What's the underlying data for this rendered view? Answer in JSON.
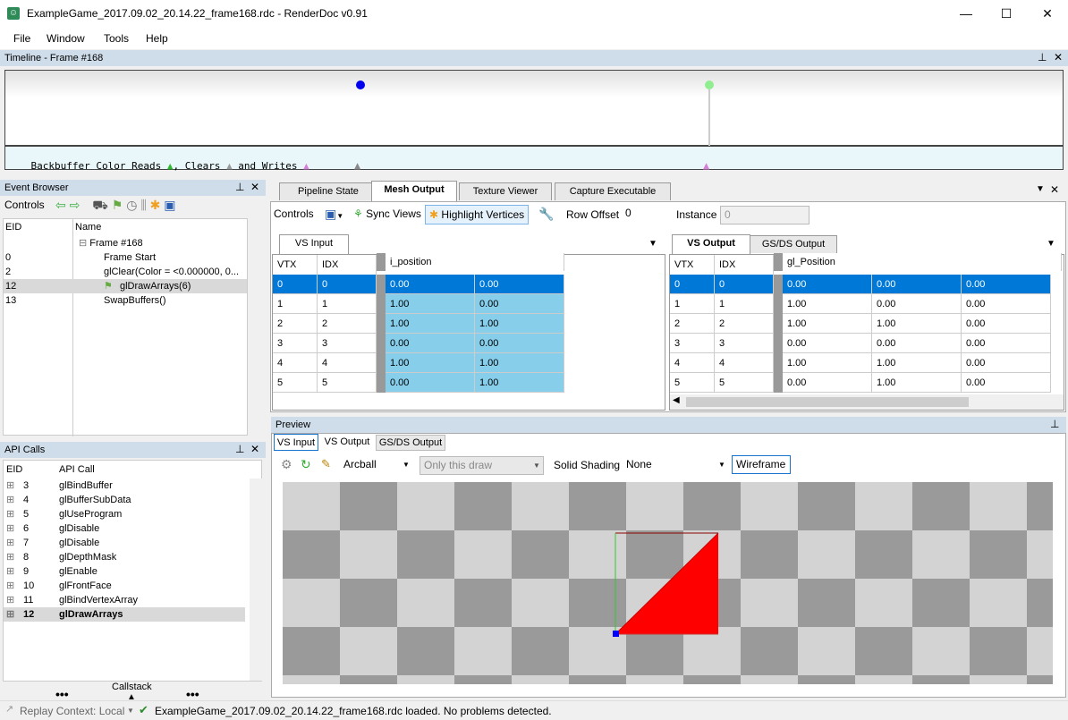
{
  "window": {
    "title": "ExampleGame_2017.09.02_20.14.22_frame168.rdc - RenderDoc v0.91",
    "minimize": "—",
    "maximize": "☐",
    "close": "✕"
  },
  "menu": [
    "File",
    "Window",
    "Tools",
    "Help"
  ],
  "timeline": {
    "title": "Timeline - Frame #168",
    "legend_a": "Backbuffer Color Reads ",
    "legend_b": ", Clears ",
    "legend_c": " and Writes "
  },
  "event_browser": {
    "title": "Event Browser",
    "controls_label": "Controls",
    "col_eid": "EID",
    "col_name": "Name",
    "rows": [
      {
        "eid": "",
        "name": "Frame #168"
      },
      {
        "eid": "0",
        "name": "Frame Start"
      },
      {
        "eid": "2",
        "name": "glClear(Color = <0.000000, 0..."
      },
      {
        "eid": "12",
        "name": "glDrawArrays(6)"
      },
      {
        "eid": "13",
        "name": "SwapBuffers()"
      }
    ]
  },
  "api_calls": {
    "title": "API Calls",
    "col_eid": "EID",
    "col_call": "API Call",
    "rows": [
      {
        "eid": "3",
        "call": "glBindBuffer"
      },
      {
        "eid": "4",
        "call": "glBufferSubData"
      },
      {
        "eid": "5",
        "call": "glUseProgram"
      },
      {
        "eid": "6",
        "call": "glDisable"
      },
      {
        "eid": "7",
        "call": "glDisable"
      },
      {
        "eid": "8",
        "call": "glDepthMask"
      },
      {
        "eid": "9",
        "call": "glEnable"
      },
      {
        "eid": "10",
        "call": "glFrontFace"
      },
      {
        "eid": "11",
        "call": "glBindVertexArray"
      },
      {
        "eid": "12",
        "call": "glDrawArrays"
      }
    ],
    "callstack": "Callstack"
  },
  "tabs": [
    "Pipeline State",
    "Mesh Output",
    "Texture Viewer",
    "Capture Executable"
  ],
  "mesh_toolbar": {
    "controls": "Controls",
    "sync_views": "Sync Views",
    "highlight_vertices": "Highlight Vertices",
    "row_offset_label": "Row Offset",
    "row_offset_value": "0",
    "instance_label": "Instance",
    "instance_value": "0"
  },
  "vs_input": {
    "tab": "VS Input",
    "col_vtx": "VTX",
    "col_idx": "IDX",
    "col_attr": "i_position",
    "rows": [
      [
        "0",
        "0",
        "0.00",
        "0.00"
      ],
      [
        "1",
        "1",
        "1.00",
        "0.00"
      ],
      [
        "2",
        "2",
        "1.00",
        "1.00"
      ],
      [
        "3",
        "3",
        "0.00",
        "0.00"
      ],
      [
        "4",
        "4",
        "1.00",
        "1.00"
      ],
      [
        "5",
        "5",
        "0.00",
        "1.00"
      ]
    ]
  },
  "vs_output": {
    "tabs": [
      "VS Output",
      "GS/DS Output"
    ],
    "col_vtx": "VTX",
    "col_idx": "IDX",
    "col_attr": "gl_Position",
    "rows": [
      [
        "0",
        "0",
        "0.00",
        "0.00",
        "0.00"
      ],
      [
        "1",
        "1",
        "1.00",
        "0.00",
        "0.00"
      ],
      [
        "2",
        "2",
        "1.00",
        "1.00",
        "0.00"
      ],
      [
        "3",
        "3",
        "0.00",
        "0.00",
        "0.00"
      ],
      [
        "4",
        "4",
        "1.00",
        "1.00",
        "0.00"
      ],
      [
        "5",
        "5",
        "0.00",
        "1.00",
        "0.00"
      ]
    ]
  },
  "preview": {
    "title": "Preview",
    "tabs": [
      "VS Input",
      "VS Output",
      "GS/DS Output"
    ],
    "camera": "Arcball",
    "draw_range": "Only this draw",
    "solid_shading_label": "Solid Shading",
    "solid_shading_value": "None",
    "wireframe": "Wireframe"
  },
  "status": {
    "replay_context": "Replay Context: Local",
    "message": "ExampleGame_2017.09.02_20.14.22_frame168.rdc loaded. No problems detected."
  },
  "colors": {
    "panel_header": "#cfdcea",
    "selection": "#0078d7",
    "highlight": "#87ceeb",
    "triangle": "#ff0000"
  }
}
